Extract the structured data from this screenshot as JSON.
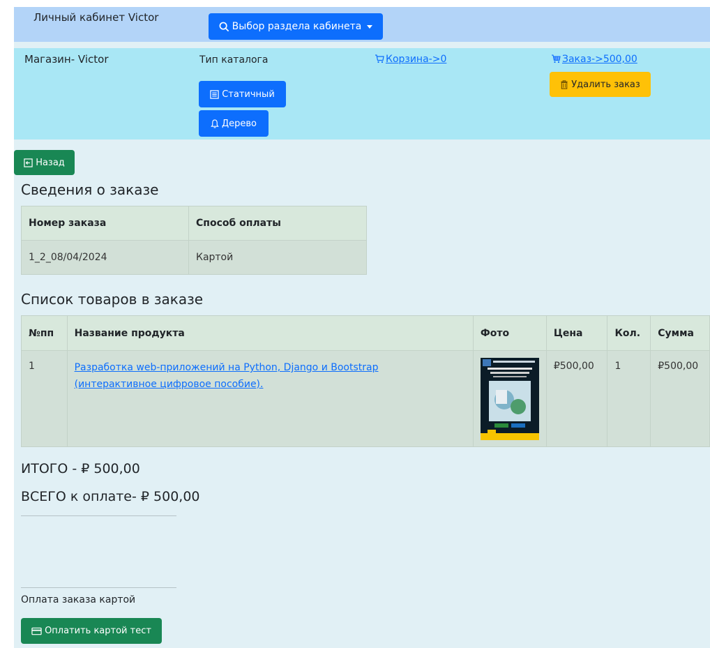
{
  "topbar": {
    "title": "Личный кабинет Victor",
    "section_select_label": "Выбор раздела кабинета"
  },
  "shop": {
    "name": "Магазин- Victor",
    "catalog_type_label": "Тип каталога",
    "static_label": "Статичный",
    "tree_label": "Дерево",
    "cart_link": "Корзина->0",
    "order_link": "Заказ->500,00",
    "delete_order_label": "Удалить заказ"
  },
  "back_label": "Назад",
  "order_info": {
    "heading": "Сведения о заказе",
    "headers": [
      "Номер заказа",
      "Способ оплаты"
    ],
    "row": [
      "1_2_08/04/2024",
      "Картой"
    ]
  },
  "products": {
    "heading": "Список товаров в заказе",
    "headers": [
      "№пп",
      "Название продукта",
      "Фото",
      "Цена",
      "Кол.",
      "Сумма"
    ],
    "rows": [
      {
        "num": "1",
        "name": "Разработка web-приложений на Python, Django и Bootstrap (интерактивное цифровое пособие).",
        "price": "₽500,00",
        "qty": "1",
        "sum": "₽500,00"
      }
    ]
  },
  "totals": {
    "itogo": "ИТОГО - ₽ 500,00",
    "vsego": "ВСЕГО к оплате- ₽ 500,00"
  },
  "payment": {
    "caption": "Оплата заказа картой",
    "button_label": "Оплатить картой тест"
  },
  "icons": {
    "search": "search-icon",
    "cart": "cart-icon",
    "basket": "basket-icon",
    "trash": "trash-icon",
    "list": "list-icon",
    "bell": "bell-icon",
    "back": "back-arrow-icon",
    "card": "credit-card-icon"
  },
  "colors": {
    "primary": "#0d6efd",
    "warning": "#ffc107",
    "success": "#198754",
    "topbar_bg": "#b3d4f8",
    "shopbar_bg": "#a9e7f5",
    "page_bg": "#e1f0f5"
  }
}
